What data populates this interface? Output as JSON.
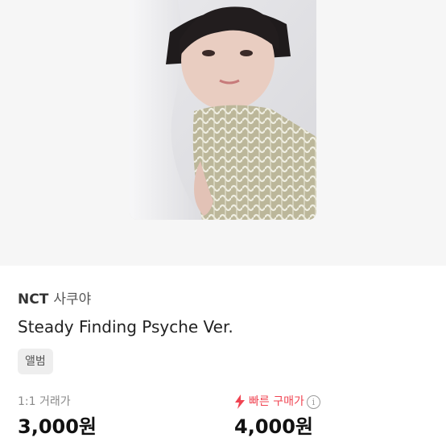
{
  "product": {
    "artist": "NCT",
    "member": "사쿠야",
    "title": "Steady Finding Psyche Ver.",
    "category": "앨범"
  },
  "prices": {
    "trade_label": "1:1 거래가",
    "trade_value": "3,000원",
    "quick_label": "빠른 구매가",
    "quick_value": "4,000원"
  },
  "icons": {
    "quick_buy": "lightning-bolt-icon",
    "info": "info-circle-icon"
  },
  "colors": {
    "accent": "#f04452",
    "hero_background": "#f6f6f6",
    "badge_background": "#eeeeee"
  }
}
